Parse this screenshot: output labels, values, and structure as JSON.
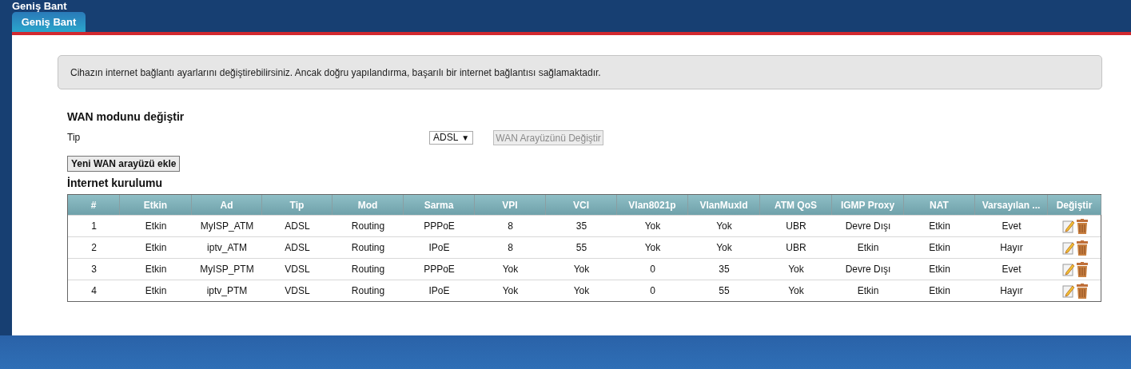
{
  "page_title": "Geniş Bant",
  "tabs": [
    {
      "label": "Geniş Bant",
      "selected": true
    }
  ],
  "info_message": "Cihazın internet bağlantı ayarlarını değiştirebilirsiniz. Ancak doğru yapılandırma, başarılı bir internet bağlantısı sağlamaktadır.",
  "wan_mode": {
    "heading": "WAN modunu değiştir",
    "type_label": "Tip",
    "type_value": "ADSL",
    "type_caret": "▼",
    "change_button": {
      "label": "WAN Arayüzünü Değiştir",
      "disabled": true
    }
  },
  "add_button": "Yeni WAN arayüzü ekle",
  "table": {
    "heading": "İnternet kurulumu",
    "columns": [
      "#",
      "Etkin",
      "Ad",
      "Tip",
      "Mod",
      "Sarma",
      "VPI",
      "VCI",
      "Vlan8021p",
      "VlanMuxId",
      "ATM QoS",
      "IGMP Proxy",
      "NAT",
      "Varsayılan ...",
      "Değiştir"
    ],
    "rows": [
      {
        "cells": [
          "1",
          "Etkin",
          "MyISP_ATM",
          "ADSL",
          "Routing",
          "PPPoE",
          "8",
          "35",
          "Yok",
          "Yok",
          "UBR",
          "Devre Dışı",
          "Etkin",
          "Evet"
        ]
      },
      {
        "cells": [
          "2",
          "Etkin",
          "iptv_ATM",
          "ADSL",
          "Routing",
          "IPoE",
          "8",
          "55",
          "Yok",
          "Yok",
          "UBR",
          "Etkin",
          "Etkin",
          "Hayır"
        ]
      },
      {
        "cells": [
          "3",
          "Etkin",
          "MyISP_PTM",
          "VDSL",
          "Routing",
          "PPPoE",
          "Yok",
          "Yok",
          "0",
          "35",
          "Yok",
          "Devre Dışı",
          "Etkin",
          "Evet"
        ]
      },
      {
        "cells": [
          "4",
          "Etkin",
          "iptv_PTM",
          "VDSL",
          "Routing",
          "IPoE",
          "Yok",
          "Yok",
          "0",
          "55",
          "Yok",
          "Etkin",
          "Etkin",
          "Hayır"
        ]
      }
    ]
  }
}
